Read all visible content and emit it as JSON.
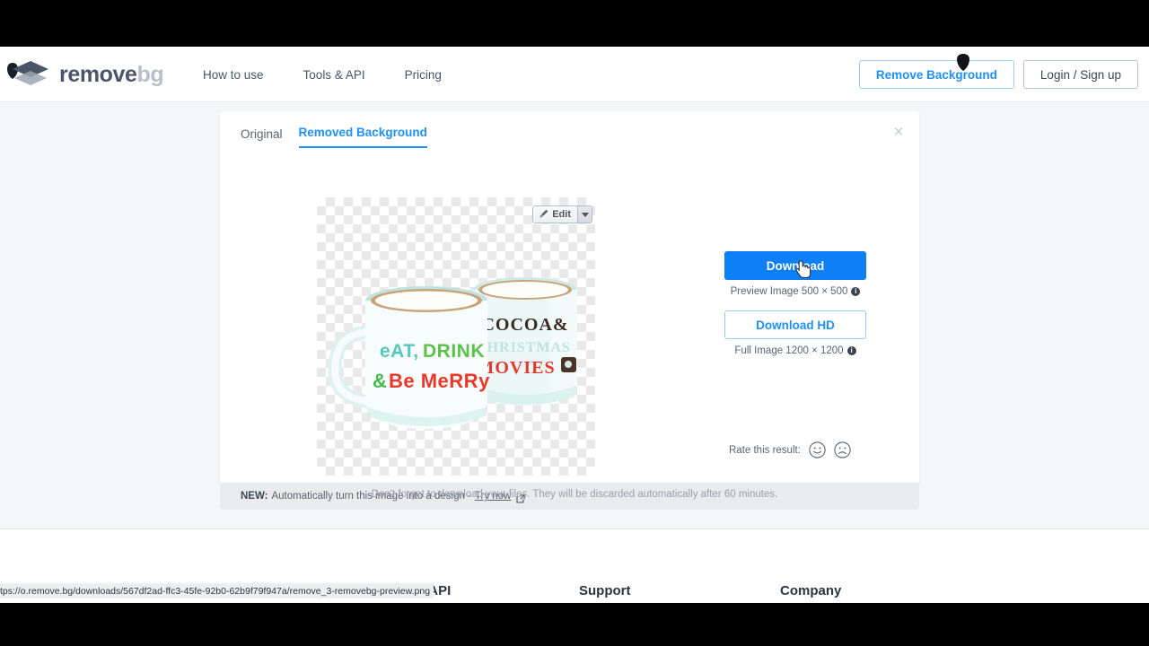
{
  "header": {
    "logo": {
      "primary": "remove",
      "secondary": "bg",
      "icon": "layers-logo-icon"
    },
    "nav": [
      {
        "label": "How to use"
      },
      {
        "label": "Tools & API"
      },
      {
        "label": "Pricing"
      }
    ],
    "remove_background_button": "Remove Background",
    "login_button": "Login / Sign up",
    "cursor_icon": "shield-cursor-icon"
  },
  "editor": {
    "tabs": [
      {
        "label": "Original",
        "active": false
      },
      {
        "label": "Removed Background",
        "active": true
      }
    ],
    "close_label": "×",
    "edit_button": {
      "label": "Edit",
      "icon": "brush-icon",
      "caret_icon": "chevron-down-icon"
    },
    "image": {
      "alt": "Two enamel christmas mugs on transparent checkerboard background",
      "left_mug_lines": [
        "EAT, DRINK",
        "& BE MERRY"
      ],
      "right_mug_lines": [
        "COCOA&",
        "CHRISTMAS",
        "MOVIES"
      ]
    },
    "download": {
      "primary_label": "Download",
      "primary_caption": "Preview Image 500 × 500",
      "hd_label": "Download HD",
      "hd_caption": "Full Image 1200 × 1200",
      "info_icon": "info-icon",
      "cursor_icon": "hand-pointer-cursor-icon"
    },
    "rate": {
      "label": "Rate this result:",
      "happy_icon": "smiley-happy-icon",
      "sad_icon": "smiley-sad-icon"
    }
  },
  "banner": {
    "new_label": "NEW:",
    "text": "Automatically turn this image into a design -",
    "link_label": "Try now",
    "external_icon": "external-link-icon"
  },
  "notice": {
    "discard_text": "Don't forget to download your files. They will be discarded automatically after 60 minutes."
  },
  "footer": {
    "headings": [
      {
        "label": "ols & API"
      },
      {
        "label": "Support"
      },
      {
        "label": "Company"
      }
    ]
  },
  "status_bar": {
    "url": "tps://o.remove.bg/downloads/567df2ad-ffc3-45fe-92b0-62b9f79f947a/remove_3-removebg-preview.png"
  },
  "colors": {
    "accent_blue": "#0d7ff7",
    "link_blue": "#1e90ff",
    "page_bg": "#f4f6f8",
    "logo_dark": "#4a5568",
    "logo_gray": "#b8bfc8"
  }
}
